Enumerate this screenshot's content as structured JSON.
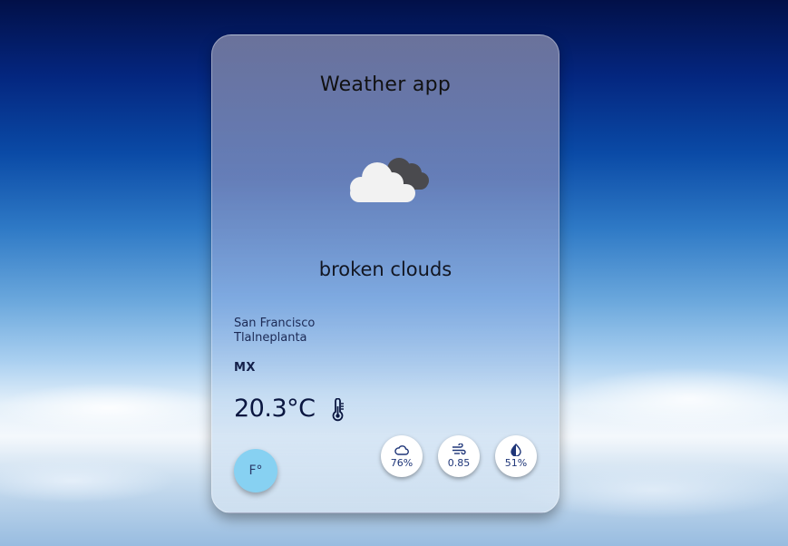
{
  "app": {
    "title": "Weather app"
  },
  "weather": {
    "icon": "broken-clouds-icon",
    "description": "broken clouds",
    "city": "San Francisco",
    "region": "Tlalneplanta",
    "country": "MX",
    "temperature": "20.3°C"
  },
  "unit_toggle": {
    "label": "F°"
  },
  "stats": {
    "clouds": {
      "icon": "cloud-icon",
      "value": "76%"
    },
    "wind": {
      "icon": "wind-icon",
      "value": "0.85"
    },
    "humidity": {
      "icon": "humidity-icon",
      "value": "51%"
    }
  },
  "colors": {
    "accent_button": "#87d1f2",
    "stat_text": "#1e3578",
    "temperature_text": "#0a1640"
  }
}
